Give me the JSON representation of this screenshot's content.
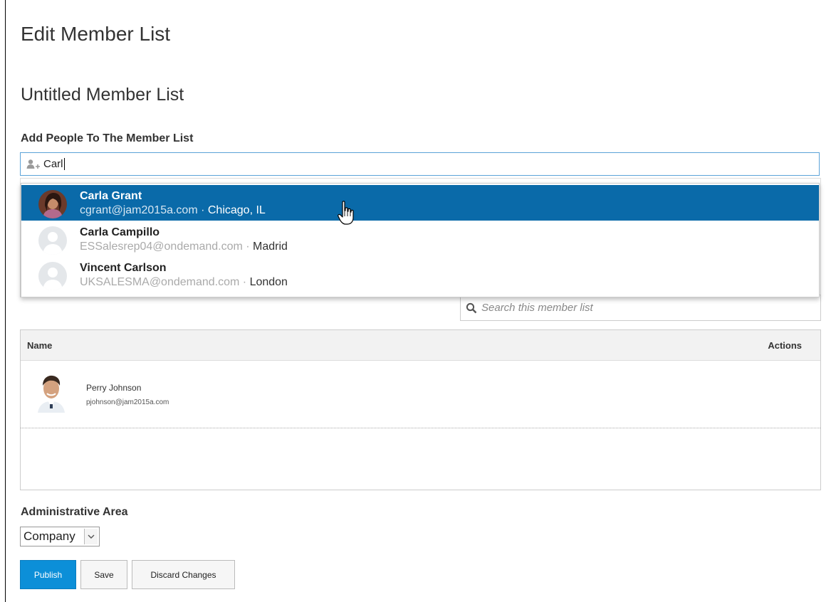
{
  "page": {
    "title": "Edit Member List",
    "list_name": "Untitled Member List"
  },
  "add_people": {
    "label": "Add People To The Member List",
    "input_value": "Carl",
    "icon": "add-user-icon"
  },
  "suggestions": [
    {
      "name": "Carla Grant",
      "email": "cgrant@jam2015a.com",
      "separator": " · ",
      "location": "Chicago, IL",
      "highlighted": true,
      "avatar": "photo"
    },
    {
      "name": "Carla Campillo",
      "email": "ESSalesrep04@ondemand.com",
      "separator": " · ",
      "location": "Madrid",
      "highlighted": false,
      "avatar": "placeholder"
    },
    {
      "name": "Vincent Carlson",
      "email": "UKSALESMA@ondemand.com",
      "separator": " · ",
      "location": "London",
      "highlighted": false,
      "avatar": "placeholder"
    }
  ],
  "search": {
    "placeholder": "Search this member list",
    "icon": "search-icon"
  },
  "table": {
    "columns": [
      "Name",
      "Actions"
    ],
    "rows": [
      {
        "name": "Perry Johnson",
        "email": "pjohnson@jam2015a.com"
      }
    ]
  },
  "admin": {
    "label": "Administrative Area",
    "selected": "Company"
  },
  "buttons": {
    "publish": "Publish",
    "save": "Save",
    "discard": "Discard Changes"
  },
  "colors": {
    "highlight": "#0a6aa9",
    "publish": "#0c8fd8",
    "input_focus": "#5ba3d8"
  }
}
